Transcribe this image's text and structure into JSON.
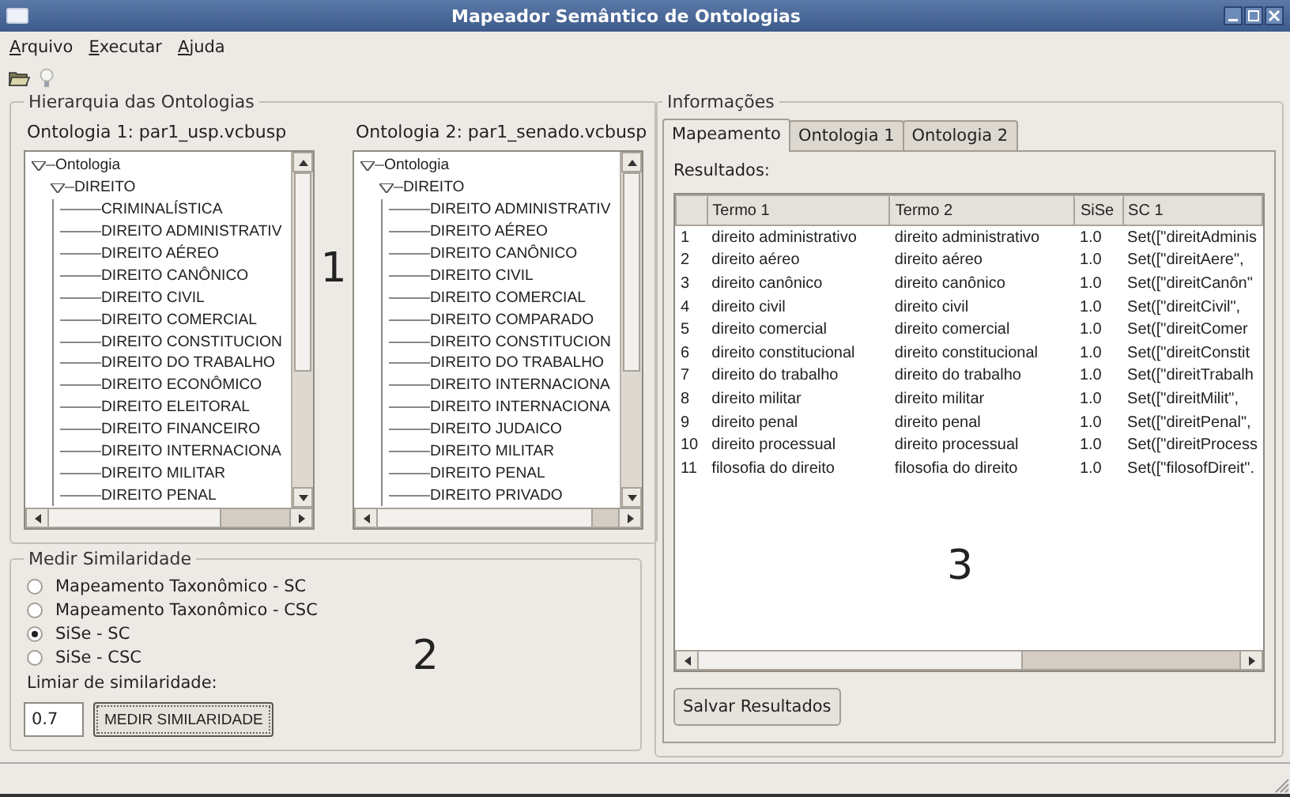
{
  "window": {
    "title": "Mapeador Semântico de Ontologias"
  },
  "menu": [
    {
      "label": "Arquivo"
    },
    {
      "label": "Executar"
    },
    {
      "label": "Ajuda"
    }
  ],
  "hierarchy": {
    "title": "Hierarquia das Ontologias",
    "annotation": "1",
    "trees": [
      {
        "label": "Ontologia 1: par1_usp.vcbusp",
        "nodes": [
          {
            "label": "Ontologia",
            "expanded": true,
            "children": [
              {
                "label": "DIREITO",
                "expanded": true,
                "children": [
                  {
                    "label": "CRIMINALÍSTICA"
                  },
                  {
                    "label": "DIREITO ADMINISTRATIV"
                  },
                  {
                    "label": "DIREITO AÉREO"
                  },
                  {
                    "label": "DIREITO CANÔNICO"
                  },
                  {
                    "label": "DIREITO CIVIL"
                  },
                  {
                    "label": "DIREITO COMERCIAL"
                  },
                  {
                    "label": "DIREITO CONSTITUCION"
                  },
                  {
                    "label": "DIREITO DO TRABALHO"
                  },
                  {
                    "label": "DIREITO ECONÔMICO"
                  },
                  {
                    "label": "DIREITO ELEITORAL"
                  },
                  {
                    "label": "DIREITO FINANCEIRO"
                  },
                  {
                    "label": "DIREITO INTERNACIONA"
                  },
                  {
                    "label": "DIREITO MILITAR"
                  },
                  {
                    "label": "DIREITO PENAL"
                  }
                ]
              }
            ]
          }
        ]
      },
      {
        "label": "Ontologia 2: par1_senado.vcbusp",
        "nodes": [
          {
            "label": "Ontologia",
            "expanded": true,
            "children": [
              {
                "label": "DIREITO",
                "expanded": true,
                "children": [
                  {
                    "label": "DIREITO ADMINISTRATIV"
                  },
                  {
                    "label": "DIREITO AÉREO"
                  },
                  {
                    "label": "DIREITO CANÔNICO"
                  },
                  {
                    "label": "DIREITO CIVIL"
                  },
                  {
                    "label": "DIREITO COMERCIAL"
                  },
                  {
                    "label": "DIREITO COMPARADO"
                  },
                  {
                    "label": "DIREITO CONSTITUCION"
                  },
                  {
                    "label": "DIREITO DO TRABALHO"
                  },
                  {
                    "label": "DIREITO INTERNACIONA"
                  },
                  {
                    "label": "DIREITO INTERNACIONA"
                  },
                  {
                    "label": "DIREITO JUDAICO"
                  },
                  {
                    "label": "DIREITO MILITAR"
                  },
                  {
                    "label": "DIREITO PENAL"
                  },
                  {
                    "label": "DIREITO PRIVADO"
                  }
                ]
              }
            ]
          }
        ]
      }
    ]
  },
  "similarity": {
    "title": "Medir Similaridade",
    "annotation": "2",
    "options": [
      {
        "label": "Mapeamento Taxonômico  - SC",
        "selected": false
      },
      {
        "label": "Mapeamento Taxonômico  - CSC",
        "selected": false
      },
      {
        "label": "SiSe - SC",
        "selected": true
      },
      {
        "label": "SiSe - CSC",
        "selected": false
      }
    ],
    "threshold_label": "Limiar de similaridade:",
    "threshold": "0.7",
    "button": "MEDIR SIMILARIDADE"
  },
  "info": {
    "title": "Informações",
    "annotation": "3",
    "tabs": [
      {
        "label": "Mapeamento",
        "selected": true
      },
      {
        "label": "Ontologia 1",
        "selected": false
      },
      {
        "label": "Ontologia 2",
        "selected": false
      }
    ],
    "results_label": "Resultados:",
    "columns": [
      "",
      "Termo 1",
      "Termo 2",
      "SiSe",
      "SC 1"
    ],
    "rows": [
      [
        "1",
        "direito administrativo",
        "direito administrativo",
        "1.0",
        "Set([\"direitAdminis"
      ],
      [
        "2",
        "direito aéreo",
        "direito aéreo",
        "1.0",
        "Set([\"direitAere\","
      ],
      [
        "3",
        "direito canônico",
        "direito canônico",
        "1.0",
        "Set([\"direitCanôn\""
      ],
      [
        "4",
        "direito civil",
        "direito civil",
        "1.0",
        "Set([\"direitCivil\","
      ],
      [
        "5",
        "direito comercial",
        "direito comercial",
        "1.0",
        "Set([\"direitComer"
      ],
      [
        "6",
        "direito constitucional",
        "direito constitucional",
        "1.0",
        "Set([\"direitConstit"
      ],
      [
        "7",
        "direito do trabalho",
        "direito do trabalho",
        "1.0",
        "Set([\"direitTrabalh"
      ],
      [
        "8",
        "direito militar",
        "direito militar",
        "1.0",
        "Set([\"direitMilit\","
      ],
      [
        "9",
        "direito penal",
        "direito penal",
        "1.0",
        "Set([\"direitPenal\","
      ],
      [
        "10",
        "direito processual",
        "direito processual",
        "1.0",
        "Set([\"direitProcess"
      ],
      [
        "11",
        "filosofia do direito",
        "filosofia do direito",
        "1.0",
        "Set([\"filosofDireit\"."
      ]
    ],
    "save_button": "Salvar Resultados"
  }
}
